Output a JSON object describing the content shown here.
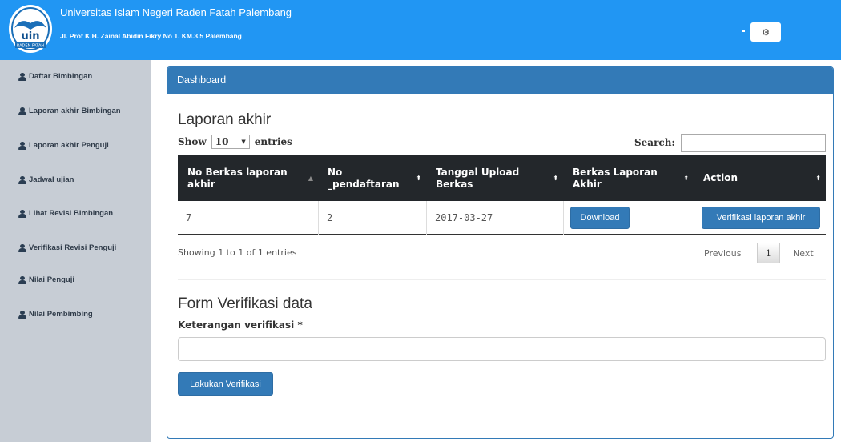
{
  "header": {
    "university": "Universitas Islam Negeri Raden Fatah Palembang",
    "address": "Jl. Prof K.H. Zainal Abidin Fikry No 1. KM.3.5 Palembang",
    "logo_text": "uin",
    "logo_subtext": "RADEN FATAH",
    "settings_icon": "gear-icon",
    "color": "#2196f3"
  },
  "sidebar": {
    "items": [
      {
        "label": "Daftar Bimbingan",
        "icon": "user-icon"
      },
      {
        "label": "Laporan akhir Bimbingan",
        "icon": "user-icon"
      },
      {
        "label": "Laporan akhir Penguji",
        "icon": "user-icon"
      },
      {
        "label": "Jadwal ujian",
        "icon": "user-icon"
      },
      {
        "label": "Lihat Revisi Bimbingan",
        "icon": "user-icon"
      },
      {
        "label": "Verifikasi Revisi Penguji",
        "icon": "user-icon"
      },
      {
        "label": "Nilai Penguji",
        "icon": "user-icon"
      },
      {
        "label": "Nilai Pembimbing",
        "icon": "user-icon"
      }
    ]
  },
  "panel": {
    "title": "Dashboard",
    "color": "#337ab7"
  },
  "laporan": {
    "heading": "Laporan akhir",
    "show_label": "Show",
    "entries_label": "entries",
    "page_length": "10",
    "search_label": "Search:",
    "search_value": "",
    "columns": [
      {
        "label": "No Berkas laporan akhir",
        "sort": "asc"
      },
      {
        "label": "No _pendaftaran",
        "sort": "both"
      },
      {
        "label": "Tanggal Upload Berkas",
        "sort": "both"
      },
      {
        "label": "Berkas Laporan Akhir",
        "sort": "both"
      },
      {
        "label": "Action",
        "sort": "both"
      }
    ],
    "rows": [
      {
        "no_berkas": "7",
        "no_pendaftaran": "2",
        "tanggal": "2017-03-27",
        "berkas_button": "Download",
        "action_button": "Verifikasi laporan akhir"
      }
    ],
    "info": "Showing 1 to 1 of 1 entries",
    "pagination": {
      "previous": "Previous",
      "current": "1",
      "next": "Next"
    }
  },
  "form": {
    "heading": "Form Verifikasi data",
    "label": "Keterangan verifikasi *",
    "value": "",
    "submit": "Lakukan Verifikasi"
  }
}
